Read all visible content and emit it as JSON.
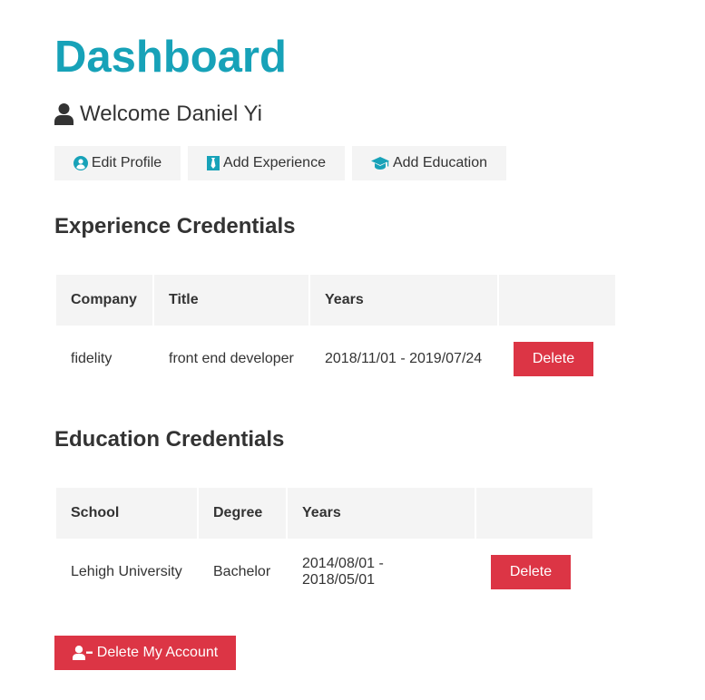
{
  "header": {
    "title": "Dashboard",
    "welcome": "Welcome Daniel Yi"
  },
  "actions": {
    "edit_profile": "Edit Profile",
    "add_experience": "Add Experience",
    "add_education": "Add Education"
  },
  "experience": {
    "heading": "Experience Credentials",
    "columns": [
      "Company",
      "Title",
      "Years",
      ""
    ],
    "rows": [
      {
        "company": "fidelity",
        "title": "front end developer",
        "years": "2018/11/01 - 2019/07/24",
        "delete_label": "Delete"
      }
    ]
  },
  "education": {
    "heading": "Education Credentials",
    "columns": [
      "School",
      "Degree",
      "Years",
      ""
    ],
    "rows": [
      {
        "school": "Lehigh University",
        "degree": "Bachelor",
        "years": "2014/08/01 - 2018/05/01",
        "delete_label": "Delete"
      }
    ]
  },
  "account": {
    "delete_label": "Delete My Account"
  },
  "colors": {
    "accent": "#17a2b8",
    "danger": "#dc3545",
    "light": "#f4f4f4",
    "text": "#333333"
  },
  "icons": {
    "welcome": "user-icon",
    "edit_profile": "user-circle-icon",
    "add_experience": "black-tie-icon",
    "add_education": "graduation-cap-icon",
    "delete_account": "user-minus-icon"
  }
}
